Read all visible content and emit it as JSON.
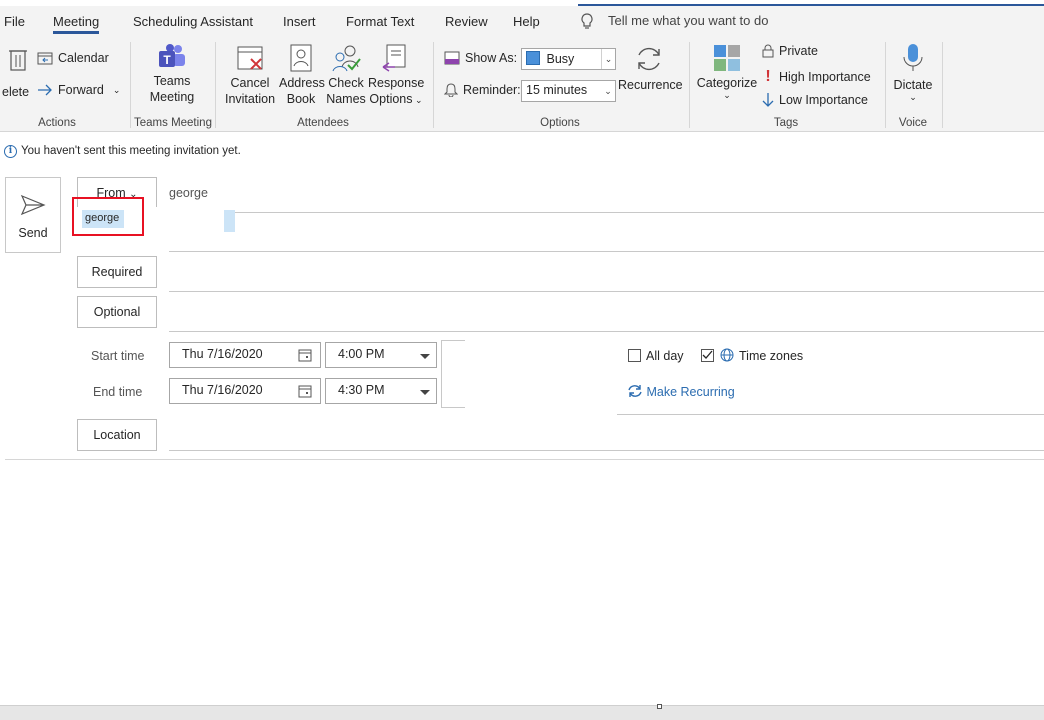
{
  "tabs": [
    "File",
    "Meeting",
    "Scheduling Assistant",
    "Insert",
    "Format Text",
    "Review",
    "Help"
  ],
  "active_tab": "Meeting",
  "tell_me": "Tell me what you want to do",
  "ribbon": {
    "actions": {
      "delete": "elete",
      "calendar": "Calendar",
      "forward": "Forward",
      "label": "Actions"
    },
    "teams": {
      "button": [
        "Teams",
        "Meeting"
      ],
      "label": "Teams Meeting"
    },
    "attendees": {
      "cancel": [
        "Cancel",
        "Invitation"
      ],
      "address": [
        "Address",
        "Book"
      ],
      "check": [
        "Check",
        "Names"
      ],
      "response": [
        "Response",
        "Options"
      ],
      "label": "Attendees"
    },
    "options": {
      "show_as_label": "Show As:",
      "show_as_value": "Busy",
      "reminder_label": "Reminder:",
      "reminder_value": "15 minutes",
      "recurrence": "Recurrence",
      "label": "Options"
    },
    "tags": {
      "categorize": "Categorize",
      "private": "Private",
      "high": "High Importance",
      "low": "Low Importance",
      "label": "Tags"
    },
    "voice": {
      "dictate": "Dictate",
      "label": "Voice"
    }
  },
  "info_message": "You haven't sent this meeting invitation yet.",
  "form": {
    "send": "Send",
    "from_label": "From",
    "from_value": "george",
    "suggestion": "george",
    "required": "Required",
    "optional": "Optional",
    "start_time_label": "Start time",
    "end_time_label": "End time",
    "start_date": "Thu 7/16/2020",
    "start_time": "4:00 PM",
    "end_date": "Thu 7/16/2020",
    "end_time": "4:30 PM",
    "all_day": "All day",
    "time_zones": "Time zones",
    "make_recurring": "Make Recurring",
    "location": "Location"
  },
  "colors": {
    "accent": "#2b579a",
    "link": "#2b6cb0",
    "highlight": "#e81123"
  }
}
